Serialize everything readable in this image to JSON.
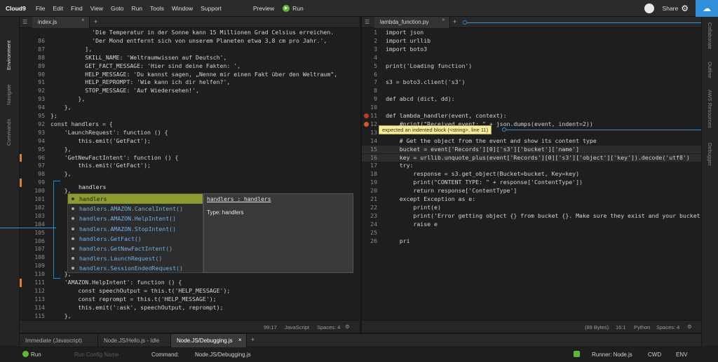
{
  "menubar": {
    "logo": "Cloud9",
    "items": [
      "File",
      "Edit",
      "Find",
      "View",
      "Goto",
      "Run",
      "Tools",
      "Window",
      "Support"
    ],
    "preview": "Preview",
    "run": "Run",
    "share": "Share"
  },
  "left_rail": [
    "Environment",
    "Navigate",
    "Commands"
  ],
  "right_rail": [
    "Collaborate",
    "Outline",
    "AWS Resources",
    "Debugger"
  ],
  "left_editor": {
    "tab": "index.js",
    "lines": [
      {
        "n": "",
        "t": "            'Die Temperatur in der Sonne kann 15 Millionen Grad Celsius erreichen."
      },
      {
        "n": "86",
        "t": "            'Der Mond entfernt sich von unserem Planeten etwa 3,8 cm pro Jahr.',"
      },
      {
        "n": "87",
        "t": "          ],"
      },
      {
        "n": "88",
        "t": "          SKILL_NAME: 'Weltraumwissen auf Deutsch',"
      },
      {
        "n": "89",
        "t": "          GET_FACT_MESSAGE: 'Hier sind deine Fakten: ',"
      },
      {
        "n": "90",
        "t": "          HELP_MESSAGE: 'Du kannst sagen, „Nenne mir einen Fakt über den Weltraum\","
      },
      {
        "n": "91",
        "t": "          HELP_REPROMPT: 'Wie kann ich dir helfen?',"
      },
      {
        "n": "92",
        "t": "          STOP_MESSAGE: 'Auf Wiedersehen!',"
      },
      {
        "n": "93",
        "t": "        },"
      },
      {
        "n": "94",
        "t": "    },"
      },
      {
        "n": "95",
        "t": "};"
      },
      {
        "n": "92",
        "t": "const handlers = {"
      },
      {
        "n": "93",
        "t": "    'LaunchRequest': function () {"
      },
      {
        "n": "94",
        "t": "        this.emit('GetFact');"
      },
      {
        "n": "95",
        "t": "    },"
      },
      {
        "n": "96",
        "t": "    'GetNewFactIntent': function () {"
      },
      {
        "n": "97",
        "t": "        this.emit('GetFact');"
      },
      {
        "n": "98",
        "t": "    },"
      },
      {
        "n": "99",
        "t": ""
      },
      {
        "n": "100",
        "t": "    },"
      },
      {
        "n": "101",
        "t": ""
      },
      {
        "n": "102",
        "t": ""
      },
      {
        "n": "103",
        "t": ""
      },
      {
        "n": "104",
        "t": ""
      },
      {
        "n": "105",
        "t": ""
      },
      {
        "n": "106",
        "t": ""
      },
      {
        "n": "107",
        "t": ""
      },
      {
        "n": "108",
        "t": ""
      },
      {
        "n": "109",
        "t": "        this.emit(':tellWithCard', speechOutput, this.t('SKILL_NAME'), randomFact);"
      },
      {
        "n": "110",
        "t": "    },"
      },
      {
        "n": "111",
        "t": "    'AMAZON.HelpIntent': function () {"
      },
      {
        "n": "112",
        "t": "        const speechOutput = this.t('HELP_MESSAGE');"
      },
      {
        "n": "113",
        "t": "        const reprompt = this.t('HELP_MESSAGE');"
      },
      {
        "n": "114",
        "t": "        this.emit(':ask', speechOutput, reprompt);"
      },
      {
        "n": "115",
        "t": "    },"
      },
      {
        "n": "116",
        "t": "    'AMAZON.CancelIntent': function () {"
      }
    ],
    "status": {
      "pos": "99:17",
      "lang": "JavaScript",
      "spaces": "Spaces: 4"
    }
  },
  "autocomplete": {
    "typed": "handlers",
    "items": [
      "handlers",
      "handlers.AMAZON.CancelIntent()",
      "handlers.AMAZON.HelpIntent()",
      "handlers.AMAZON.StopIntent()",
      "handlers.GetFact()",
      "handlers.GetNewFactIntent()",
      "handlers.LaunchRequest()",
      "handlers.SessionEndedRequest()"
    ],
    "doc_title": "handlers : handlers",
    "doc_type": "Type: handlers"
  },
  "right_editor": {
    "tab": "lambda_function.py",
    "lines": [
      {
        "n": "1",
        "t": "import json"
      },
      {
        "n": "2",
        "t": "import urllib"
      },
      {
        "n": "3",
        "t": "import boto3"
      },
      {
        "n": "4",
        "t": ""
      },
      {
        "n": "5",
        "t": "print('Loading function')"
      },
      {
        "n": "6",
        "t": ""
      },
      {
        "n": "7",
        "t": "s3 = boto3.client('s3')"
      },
      {
        "n": "8",
        "t": ""
      },
      {
        "n": "9",
        "t": "def abcd (dict, dd):"
      },
      {
        "n": "10",
        "t": ""
      },
      {
        "n": "11",
        "t": "def lambda_handler(event, context):"
      },
      {
        "n": "12",
        "t": "    #print(\"Received event: \" + json.dumps(event, indent=2))"
      },
      {
        "n": "13",
        "t": ""
      },
      {
        "n": "14",
        "t": "    # Get the object from the event and show its content type"
      },
      {
        "n": "15",
        "t": "    bucket = event['Records'][0]['s3']['bucket']['name']"
      },
      {
        "n": "16",
        "t": "    key = urllib.unquote_plus(event['Records'][0]['s3']['object']['key']).decode('utf8')"
      },
      {
        "n": "17",
        "t": "    try:"
      },
      {
        "n": "18",
        "t": "        response = s3.get_object(Bucket=bucket, Key=key)"
      },
      {
        "n": "19",
        "t": "        print(\"CONTENT TYPE: \" + response['ContentType'])"
      },
      {
        "n": "20",
        "t": "        return response['ContentType']"
      },
      {
        "n": "21",
        "t": "    except Exception as e:"
      },
      {
        "n": "22",
        "t": "        print(e)"
      },
      {
        "n": "23",
        "t": "        print('Error getting object {} from bucket {}. Make sure they exist and your bucket'"
      },
      {
        "n": "24",
        "t": "        raise e"
      },
      {
        "n": "25",
        "t": ""
      },
      {
        "n": "26",
        "t": "    pri"
      }
    ],
    "tooltip": "expected an indented block (<string>, line 11)",
    "status": {
      "bytes": "(89 Bytes)",
      "pos": "16:1",
      "lang": "Python",
      "spaces": "Spaces: 4"
    }
  },
  "console": {
    "tabs": [
      "Immediate (Javascript)",
      "Node.JS/Hello.js - Idle",
      "Node.JS/Debugging.js"
    ],
    "run": "Run",
    "config_placeholder": "Run Config Name",
    "command_label": "Command:",
    "command_value": "Node.JS/Debugging.js",
    "runner": "Runner: Node.js",
    "cwd": "CWD",
    "env": "ENV"
  }
}
